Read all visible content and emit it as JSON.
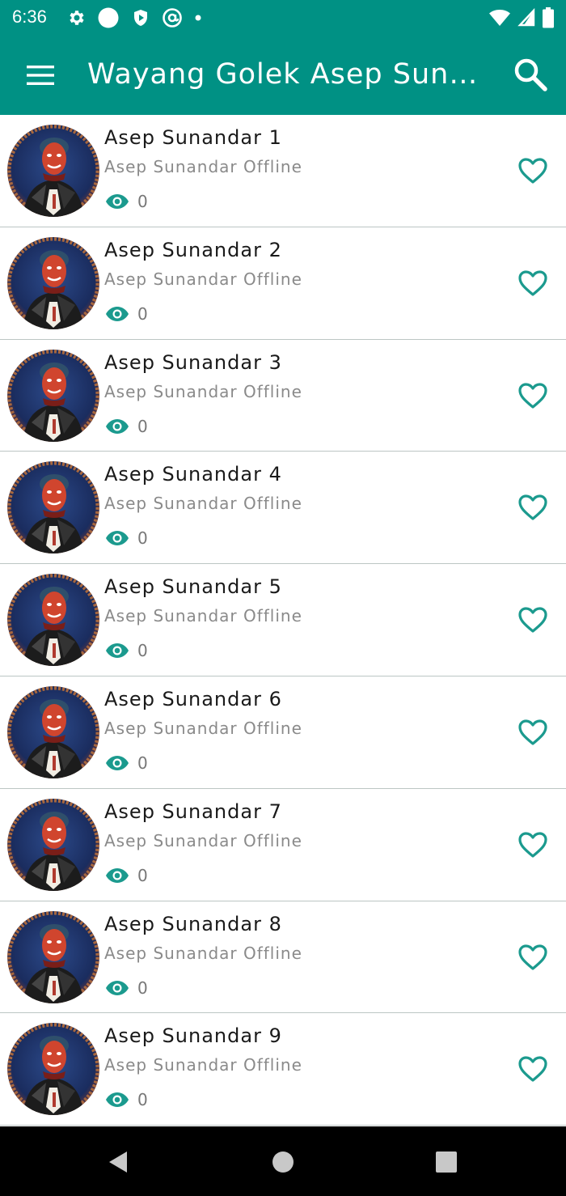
{
  "status_bar": {
    "time": "6:36",
    "left_icons": [
      "gear-icon",
      "circle-icon",
      "shield-icon",
      "at-sign-icon",
      "dot-icon"
    ],
    "right_icons": [
      "wifi-icon",
      "signal-icon",
      "battery-icon"
    ]
  },
  "app_bar": {
    "title": "Wayang Golek Asep Sunandar Offline",
    "menu_icon": "hamburger-menu-icon",
    "search_icon": "search-icon",
    "background": "#009184"
  },
  "items": [
    {
      "title": "Asep Sunandar 1",
      "subtitle": "Asep Sunandar Offline",
      "views": "0"
    },
    {
      "title": "Asep Sunandar 2",
      "subtitle": "Asep Sunandar Offline",
      "views": "0"
    },
    {
      "title": "Asep Sunandar 3",
      "subtitle": "Asep Sunandar Offline",
      "views": "0"
    },
    {
      "title": "Asep Sunandar 4",
      "subtitle": "Asep Sunandar Offline",
      "views": "0"
    },
    {
      "title": "Asep Sunandar 5",
      "subtitle": "Asep Sunandar Offline",
      "views": "0"
    },
    {
      "title": "Asep Sunandar 6",
      "subtitle": "Asep Sunandar Offline",
      "views": "0"
    },
    {
      "title": "Asep Sunandar 7",
      "subtitle": "Asep Sunandar Offline",
      "views": "0"
    },
    {
      "title": "Asep Sunandar 8",
      "subtitle": "Asep Sunandar Offline",
      "views": "0"
    },
    {
      "title": "Asep Sunandar 9",
      "subtitle": "Asep Sunandar Offline",
      "views": "0"
    }
  ],
  "colors": {
    "accent": "#009184",
    "icon_teal": "#1b9a8e",
    "divider": "#bcc6c4"
  },
  "nav_bar": {
    "buttons": [
      "back-icon",
      "home-icon",
      "recents-icon"
    ]
  }
}
